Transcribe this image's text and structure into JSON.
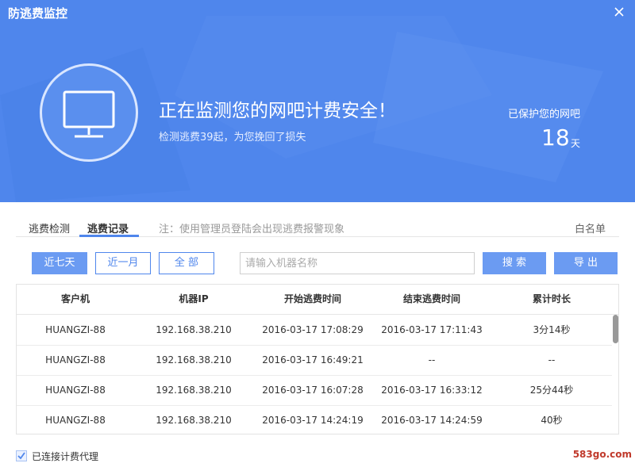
{
  "window": {
    "title": "防逃费监控"
  },
  "header": {
    "status_main": "正在监测您的网吧计费安全！",
    "status_sub": "检测逃费39起，为您挽回了损失",
    "protect_label": "已保护您的网吧",
    "protect_days": "18",
    "protect_unit": "天",
    "icon": "monitor-icon"
  },
  "tabs": [
    {
      "label": "逃费检测",
      "active": false
    },
    {
      "label": "逃费记录",
      "active": true
    }
  ],
  "tab_note": "注：使用管理员登陆会出现逃费报警现象",
  "whitelist_label": "白名单",
  "filters": {
    "last7": "近七天",
    "last_month": "近一月",
    "all": "全 部",
    "search_placeholder": "请输入机器名称",
    "search_button": "搜 索",
    "export_button": "导 出"
  },
  "table": {
    "columns": [
      "客户机",
      "机器IP",
      "开始逃费时间",
      "结束逃费时间",
      "累计时长"
    ],
    "rows": [
      [
        "HUANGZI-88",
        "192.168.38.210",
        "2016-03-17 17:08:29",
        "2016-03-17 17:11:43",
        "3分14秒"
      ],
      [
        "HUANGZI-88",
        "192.168.38.210",
        "2016-03-17 16:49:21",
        "--",
        "--"
      ],
      [
        "HUANGZI-88",
        "192.168.38.210",
        "2016-03-17 16:07:28",
        "2016-03-17 16:33:12",
        "25分44秒"
      ],
      [
        "HUANGZI-88",
        "192.168.38.210",
        "2016-03-17 14:24:19",
        "2016-03-17 14:24:59",
        "40秒"
      ]
    ]
  },
  "footer": {
    "checkbox_label": "已连接计费代理",
    "checked": true
  },
  "watermark": "583go.com",
  "colors": {
    "header_bg": "#4f86ec",
    "accent": "#4f86ec",
    "primary_button": "#6b9bf2"
  }
}
